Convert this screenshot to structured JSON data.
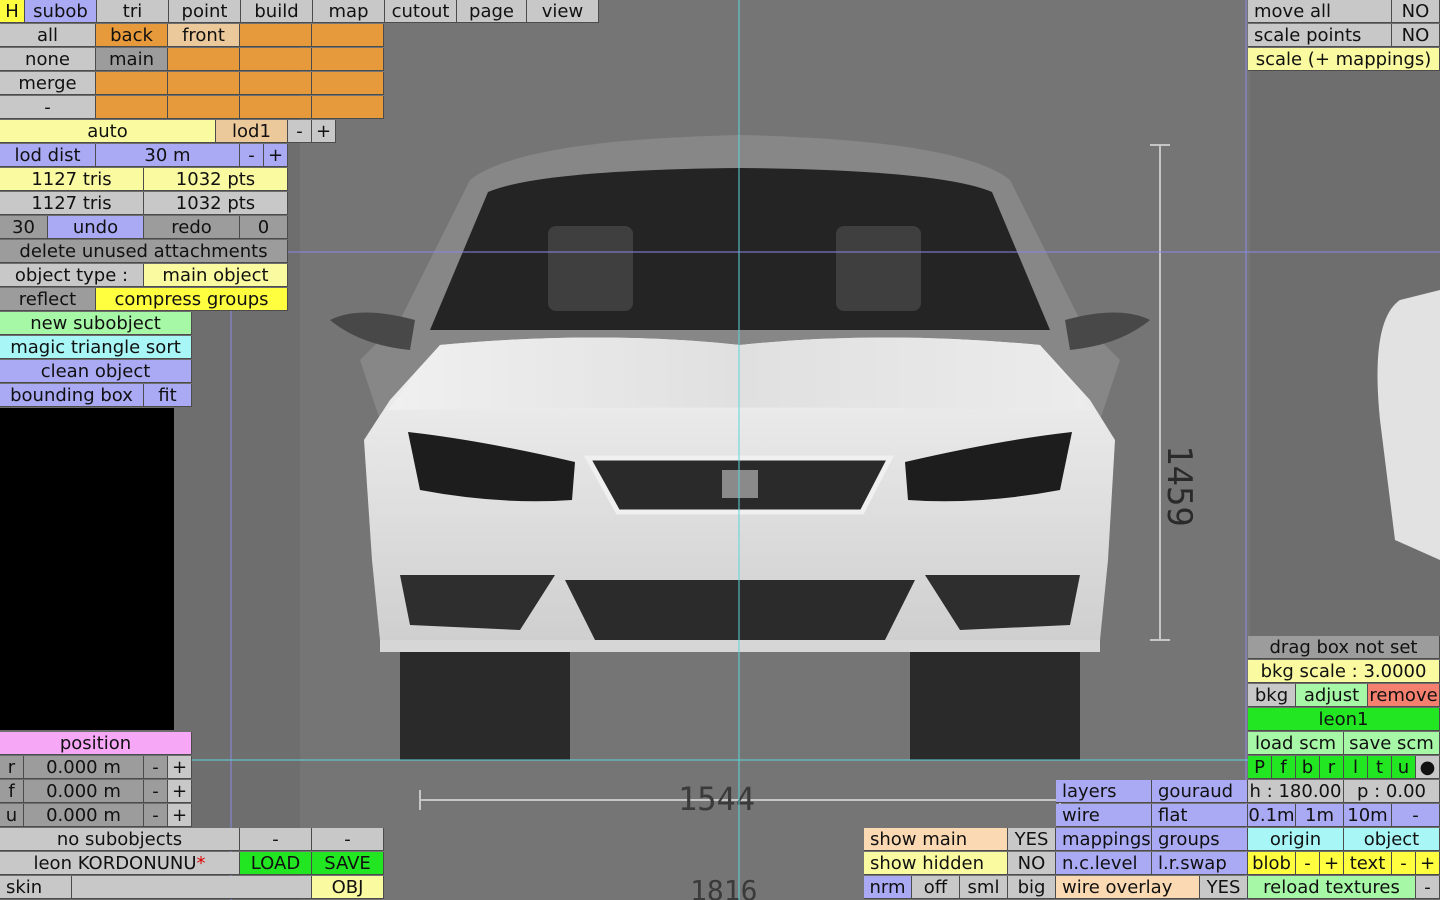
{
  "menu": {
    "h": "H",
    "items": [
      "subob",
      "tri",
      "point",
      "build",
      "map",
      "cutout",
      "page",
      "view"
    ]
  },
  "selection": {
    "row1": [
      "all",
      "back",
      "front"
    ],
    "row2": [
      "none",
      "main"
    ],
    "row3": [
      "merge"
    ],
    "row4": [
      "-"
    ]
  },
  "lod": {
    "auto": "auto",
    "lod1": "lod1",
    "minus": "-",
    "plus": "+",
    "dist_label": "lod dist",
    "dist_value": "30 m"
  },
  "stats": {
    "tris1": "1127 tris",
    "pts1": "1032 pts",
    "tris2": "1127 tris",
    "pts2": "1032 pts"
  },
  "history": {
    "count": "30",
    "undo": "undo",
    "redo": "redo",
    "redo_count": "0"
  },
  "actions": {
    "delete_unused": "delete unused attachments",
    "object_type_label": "object type :",
    "object_type_value": "main object",
    "reflect": "reflect",
    "compress": "compress groups",
    "new_subobject": "new subobject",
    "magic_sort": "magic triangle sort",
    "clean": "clean object",
    "bbox": "bounding box",
    "fit": "fit"
  },
  "position": {
    "title": "position",
    "rows": [
      {
        "axis": "r",
        "value": "0.000 m"
      },
      {
        "axis": "f",
        "value": "0.000 m"
      },
      {
        "axis": "u",
        "value": "0.000 m"
      }
    ],
    "minus": "-",
    "plus": "+"
  },
  "bottom_left": {
    "no_subobjects": "no subobjects",
    "dash": "-",
    "file": "leon KORDONUNU",
    "modified": "*",
    "load": "LOAD",
    "save": "SAVE",
    "skin": "skin",
    "obj": "OBJ"
  },
  "show": {
    "main_label": "show main",
    "main_value": "YES",
    "hidden_label": "show hidden",
    "hidden_value": "NO",
    "nrm": "nrm",
    "off": "off",
    "sml": "sml",
    "big": "big"
  },
  "render": {
    "layers": "layers",
    "gouraud": "gouraud",
    "wire": "wire",
    "flat": "flat",
    "mappings": "mappings",
    "groups": "groups",
    "nclevel": "n.c.level",
    "lrswap": "l.r.swap",
    "wire_overlay": "wire overlay",
    "wire_overlay_value": "YES"
  },
  "top_right": {
    "move_all": "move all",
    "move_all_value": "NO",
    "scale_points": "scale points",
    "scale_points_value": "NO",
    "scale_map": "scale (+ mappings)"
  },
  "bkg": {
    "drag": "drag box not set",
    "scale": "bkg scale : 3.0000",
    "bkg": "bkg",
    "adjust": "adjust",
    "remove": "remove",
    "name": "leon1",
    "load_scm": "load scm",
    "save_scm": "save scm",
    "letters": [
      "P",
      "f",
      "b",
      "r",
      "l",
      "t",
      "u"
    ],
    "dot": "●",
    "h": "h : 180.00",
    "p": "p : 0.00",
    "steps": [
      "0.1m",
      "1m",
      "10m"
    ],
    "minus": "-",
    "origin": "origin",
    "object": "object",
    "blob": "blob",
    "text": "text",
    "plus": "+",
    "reload": "reload textures"
  },
  "blueprint": {
    "height_dim": "1459",
    "width_dim": "1544",
    "bottom_dim": "1816"
  },
  "colors": {
    "viewport_bg": "#6f6f6f",
    "guide_line": "#5ad6dc",
    "car_body": "#e6e6e6"
  }
}
